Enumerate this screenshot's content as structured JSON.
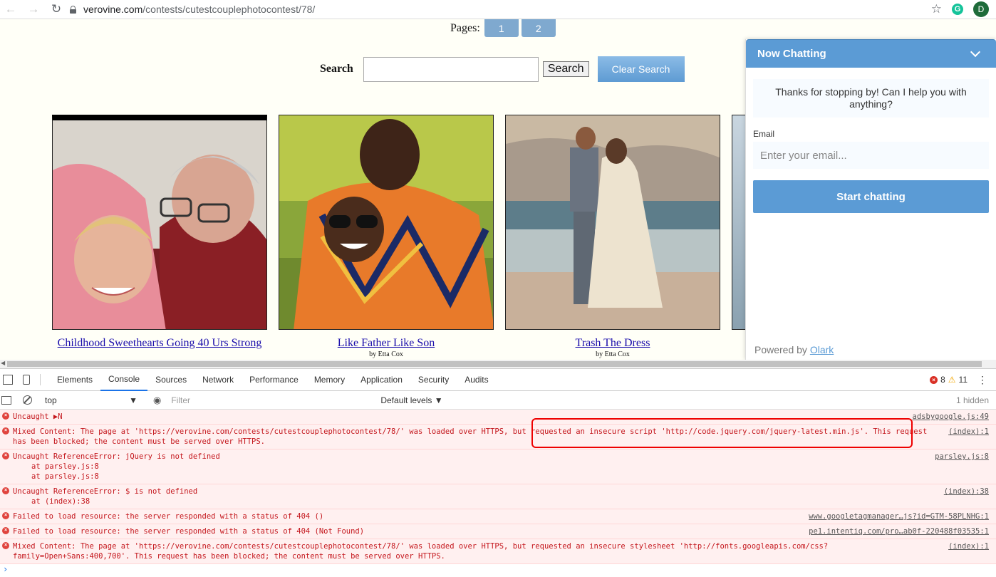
{
  "browser": {
    "url_host": "verovine.com",
    "url_path": "/contests/cutestcouplephotocontest/78/",
    "profile_initial": "D"
  },
  "page": {
    "pages_label": "Pages:",
    "page_buttons": [
      "1",
      "2"
    ],
    "search_label": "Search",
    "search_button": "Search",
    "clear_search_button": "Clear Search",
    "photos": [
      {
        "caption": "Childhood Sweethearts Going 40 Urs Strong",
        "byline": ""
      },
      {
        "caption": "Like Father Like Son",
        "byline": "by Etta Cox"
      },
      {
        "caption": "Trash The Dress",
        "byline": "by Etta Cox"
      }
    ]
  },
  "chat": {
    "title": "Now Chatting",
    "welcome": "Thanks for stopping by! Can I help you with anything?",
    "email_label": "Email",
    "email_placeholder": "Enter your email...",
    "start_button": "Start chatting",
    "powered_prefix": "Powered by",
    "powered_link": "Olark"
  },
  "devtools": {
    "tabs": [
      "Elements",
      "Console",
      "Sources",
      "Network",
      "Performance",
      "Memory",
      "Application",
      "Security",
      "Audits"
    ],
    "active_tab": "Console",
    "error_count": "8",
    "warning_count": "11",
    "context": "top",
    "filter_placeholder": "Filter",
    "levels": "Default levels ▼",
    "hidden": "1 hidden",
    "messages": [
      {
        "text": "Uncaught ▶N",
        "source": "adsbygoogle.js:49",
        "stack": []
      },
      {
        "text": "Mixed Content: The page at 'https://verovine.com/contests/cutestcouplephotocontest/78/' was loaded over HTTPS, but requested an insecure script 'http://code.jquery.com/jquery-latest.min.js'. This request has been blocked; the content must be served over HTTPS.",
        "source": "(index):1",
        "stack": []
      },
      {
        "text": "Uncaught ReferenceError: jQuery is not defined",
        "source": "parsley.js:8",
        "stack": [
          "at parsley.js:8",
          "at parsley.js:8"
        ]
      },
      {
        "text": "Uncaught ReferenceError: $ is not defined",
        "source": "(index):38",
        "stack": [
          "at (index):38"
        ]
      },
      {
        "text": "Failed to load resource: the server responded with a status of 404 ()",
        "source": "www.googletagmanager…js?id=GTM-58PLNHG:1",
        "stack": []
      },
      {
        "text": "Failed to load resource: the server responded with a status of 404 (Not Found)",
        "source": "pe1.intentiq.com/pro…ab0f-220488f03535:1",
        "stack": []
      },
      {
        "text": "Mixed Content: The page at 'https://verovine.com/contests/cutestcouplephotocontest/78/' was loaded over HTTPS, but requested an insecure stylesheet 'http://fonts.googleapis.com/css?family=Open+Sans:400,700'. This request has been blocked; the content must be served over HTTPS.",
        "source": "(index):1",
        "stack": []
      }
    ]
  },
  "colors": {
    "chat_blue": "#5b9bd5",
    "error_red": "#c4161c",
    "highlight": "#ee0000"
  }
}
